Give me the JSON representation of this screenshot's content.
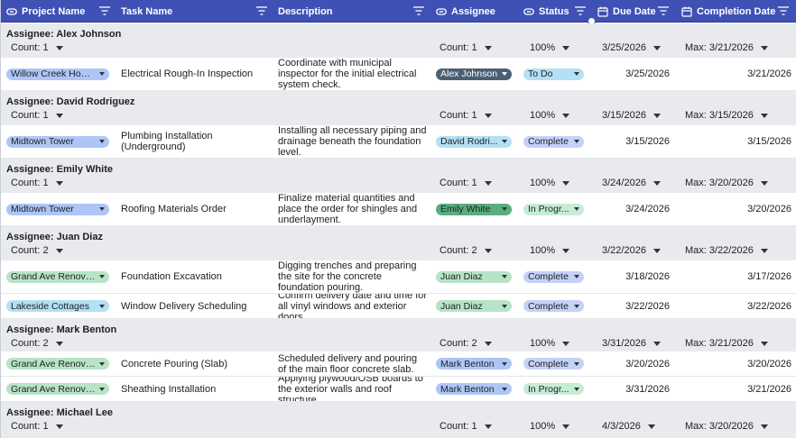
{
  "header": {
    "project": "Project Name",
    "task": "Task Name",
    "description": "Description",
    "assignee": "Assignee",
    "status": "Status",
    "due": "Due Date",
    "completion": "Completion Date"
  },
  "colors": {
    "header_bg": "#3f51b5",
    "group_bg": "#e8eaee",
    "chip_blue": "#aec6f6",
    "chip_green": "#b7e4c7",
    "chip_light_blue": "#b3e0f5",
    "chip_dark_slate": "#4a6072",
    "chip_dark_green": "#5aad7e",
    "chip_status_complete": "#c5d2f8",
    "chip_status_progress": "#c6ecd5",
    "chip_status_todo": "#b3e0f5"
  },
  "groups": [
    {
      "title": "Assignee: Alex Johnson",
      "count_left": "Count: 1",
      "count_right": "Count: 1",
      "percent": "100%",
      "due": "3/25/2026",
      "max_completion": "Max: 3/21/2026",
      "rows": [
        {
          "project": "Willow Creek Homes",
          "task": "Electrical Rough-In Inspection",
          "description": "Coordinate with municipal inspector for the initial electrical system check.",
          "assignee": "Alex Johnson",
          "status": "To Do",
          "due": "3/25/2026",
          "completion": "3/21/2026"
        }
      ]
    },
    {
      "title": "Assignee: David Rodriguez",
      "count_left": "Count: 1",
      "count_right": "Count: 1",
      "percent": "100%",
      "due": "3/15/2026",
      "max_completion": "Max: 3/15/2026",
      "rows": [
        {
          "project": "Midtown Tower",
          "task": "Plumbing Installation (Underground)",
          "description": "Installing all necessary piping and drainage beneath the foundation level.",
          "assignee": "David Rodri...",
          "status": "Complete",
          "due": "3/15/2026",
          "completion": "3/15/2026"
        }
      ]
    },
    {
      "title": "Assignee: Emily White",
      "count_left": "Count: 1",
      "count_right": "Count: 1",
      "percent": "100%",
      "due": "3/24/2026",
      "max_completion": "Max: 3/20/2026",
      "rows": [
        {
          "project": "Midtown Tower",
          "task": "Roofing Materials Order",
          "description": "Finalize material quantities and place the order for shingles and underlayment.",
          "assignee": "Emily White",
          "status": "In Progr...",
          "due": "3/24/2026",
          "completion": "3/20/2026"
        }
      ]
    },
    {
      "title": "Assignee: Juan Diaz",
      "count_left": "Count: 2",
      "count_right": "Count: 2",
      "percent": "100%",
      "due": "3/22/2026",
      "max_completion": "Max: 3/22/2026",
      "rows": [
        {
          "project": "Grand Ave Renovat...",
          "task": "Foundation Excavation",
          "description": "Digging trenches and preparing the site for the concrete foundation pouring.",
          "assignee": "Juan Diaz",
          "status": "Complete",
          "due": "3/18/2026",
          "completion": "3/17/2026"
        },
        {
          "project": "Lakeside Cottages",
          "task": "Window Delivery Scheduling",
          "description": "Confirm delivery date and time for all vinyl windows and exterior doors.",
          "assignee": "Juan Diaz",
          "status": "Complete",
          "due": "3/22/2026",
          "completion": "3/22/2026"
        }
      ]
    },
    {
      "title": "Assignee: Mark Benton",
      "count_left": "Count: 2",
      "count_right": "Count: 2",
      "percent": "100%",
      "due": "3/31/2026",
      "max_completion": "Max: 3/21/2026",
      "rows": [
        {
          "project": "Grand Ave Renovat...",
          "task": "Concrete Pouring (Slab)",
          "description": "Scheduled delivery and pouring of the main floor concrete slab.",
          "assignee": "Mark Benton",
          "status": "Complete",
          "due": "3/20/2026",
          "completion": "3/20/2026"
        },
        {
          "project": "Grand Ave Renovat...",
          "task": "Sheathing Installation",
          "description": "Applying plywood/OSB boards to the exterior walls and roof structure.",
          "assignee": "Mark Benton",
          "status": "In Progr...",
          "due": "3/31/2026",
          "completion": "3/21/2026"
        }
      ]
    },
    {
      "title": "Assignee: Michael Lee",
      "count_left": "Count: 1",
      "count_right": "Count: 1",
      "percent": "100%",
      "due": "4/3/2026",
      "max_completion": "Max: 3/20/2026",
      "rows": []
    }
  ]
}
